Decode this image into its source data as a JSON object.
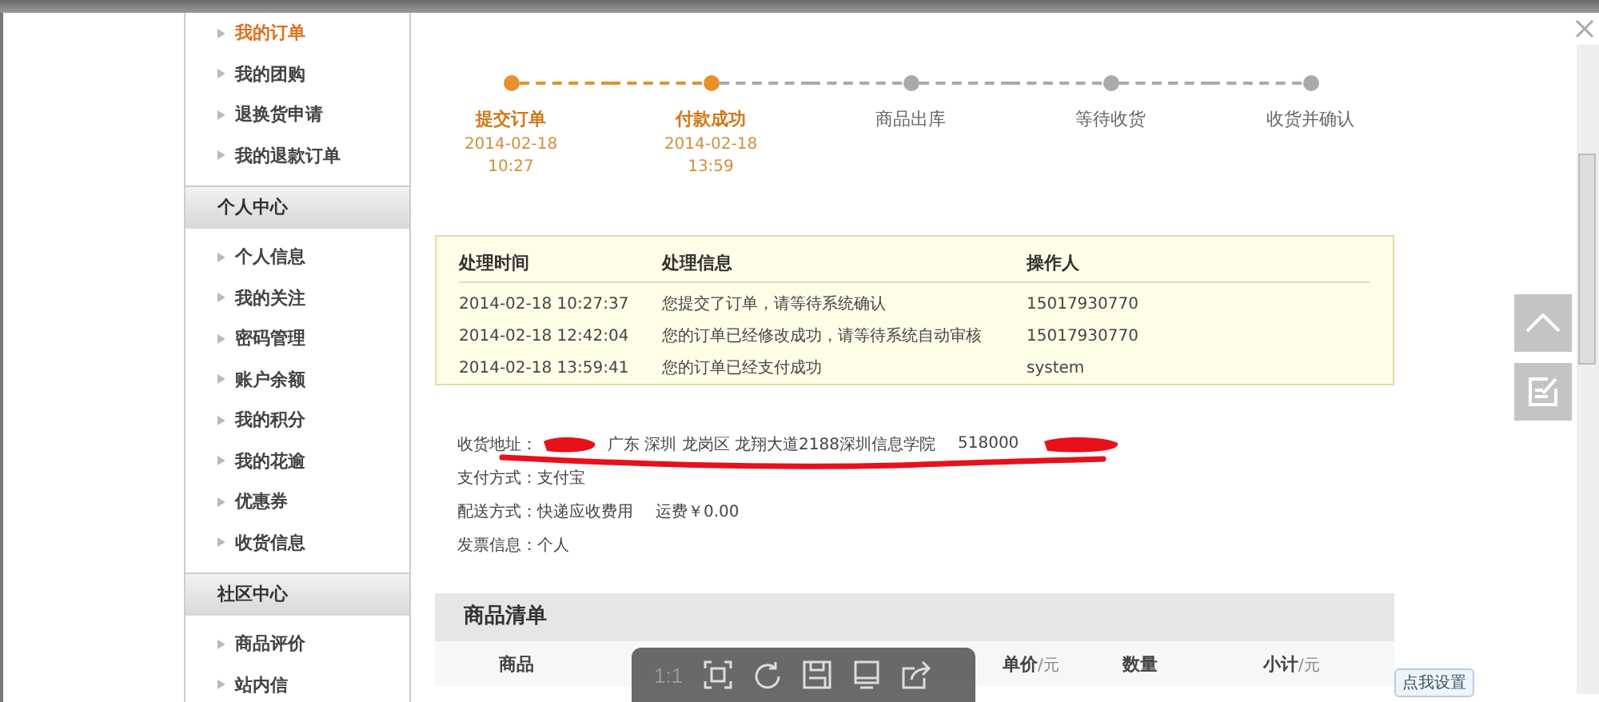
{
  "sidebar": {
    "groups": [
      {
        "items": [
          {
            "label": "我的订单",
            "selected": true
          },
          {
            "label": "我的团购",
            "selected": false
          },
          {
            "label": "退换货申请",
            "selected": false
          },
          {
            "label": "我的退款订单",
            "selected": false
          }
        ]
      },
      {
        "heading": "个人中心",
        "items": [
          {
            "label": "个人信息",
            "selected": false
          },
          {
            "label": "我的关注",
            "selected": false
          },
          {
            "label": "密码管理",
            "selected": false
          },
          {
            "label": "账户余额",
            "selected": false
          },
          {
            "label": "我的积分",
            "selected": false
          },
          {
            "label": "我的花逾",
            "selected": false
          },
          {
            "label": "优惠券",
            "selected": false
          },
          {
            "label": "收货信息",
            "selected": false
          }
        ]
      },
      {
        "heading": "社区中心",
        "items": [
          {
            "label": "商品评价",
            "selected": false
          },
          {
            "label": "站内信",
            "selected": false
          }
        ]
      }
    ]
  },
  "steps": [
    {
      "label": "提交订单",
      "done": true,
      "date": "2014-02-18",
      "time": "10:27"
    },
    {
      "label": "付款成功",
      "done": true,
      "date": "2014-02-18",
      "time": "13:59"
    },
    {
      "label": "商品出库",
      "done": false
    },
    {
      "label": "等待收货",
      "done": false
    },
    {
      "label": "收货并确认",
      "done": false
    }
  ],
  "log": {
    "columns": [
      "处理时间",
      "处理信息",
      "操作人"
    ],
    "rows": [
      [
        "2014-02-18 10:27:37",
        "您提交了订单，请等待系统确认",
        "15017930770"
      ],
      [
        "2014-02-18 12:42:04",
        "您的订单已经修改成功，请等待系统自动审核",
        "15017930770"
      ],
      [
        "2014-02-18 13:59:41",
        "您的订单已经支付成功",
        "system"
      ]
    ]
  },
  "info": [
    {
      "label": "收货地址：",
      "value": "广东 深圳 龙岗区 龙翔大道2188深圳信息学院",
      "extra": "518000",
      "redacted": true
    },
    {
      "label": "支付方式：",
      "value": "支付宝"
    },
    {
      "label": "配送方式：",
      "value": "快递应收费用",
      "extra": "运费￥0.00"
    },
    {
      "label": "发票信息：",
      "value": "个人"
    }
  ],
  "goods": {
    "title": "商品清单",
    "columns": [
      {
        "label": "商品"
      },
      {
        "label": "单价",
        "unit": "/元"
      },
      {
        "label": "数量"
      },
      {
        "label": "小计",
        "unit": "/元"
      }
    ]
  },
  "viewer_toolbar": {
    "zoom_label": "1:1"
  },
  "settings_button": "点我设置"
}
